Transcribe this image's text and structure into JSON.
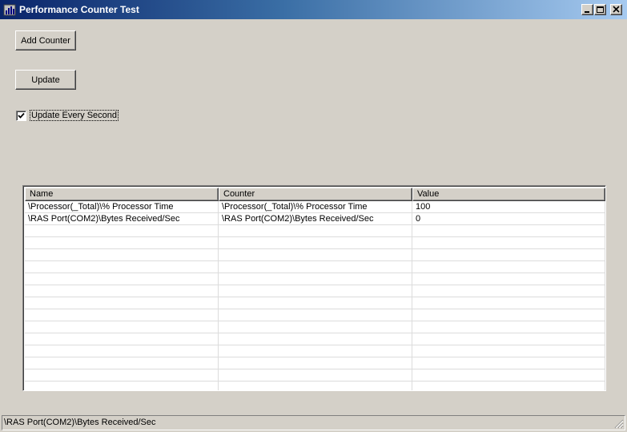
{
  "window": {
    "title": "Performance Counter Test",
    "icon": "performance-app-icon",
    "controls": [
      "minimize-icon",
      "maximize-icon",
      "close-icon"
    ]
  },
  "buttons": {
    "add_counter": "Add Counter",
    "update": "Update"
  },
  "update_every_second": {
    "label": "Update Every Second",
    "checked": true
  },
  "list": {
    "columns": [
      "Name",
      "Counter",
      "Value"
    ],
    "rows": [
      [
        "\\Processor(_Total)\\% Processor Time",
        "\\Processor(_Total)\\% Processor Time",
        "100"
      ],
      [
        "\\RAS Port(COM2)\\Bytes Received/Sec",
        "\\RAS Port(COM2)\\Bytes Received/Sec",
        "0"
      ]
    ]
  },
  "status": {
    "text": "\\RAS Port(COM2)\\Bytes Received/Sec"
  }
}
